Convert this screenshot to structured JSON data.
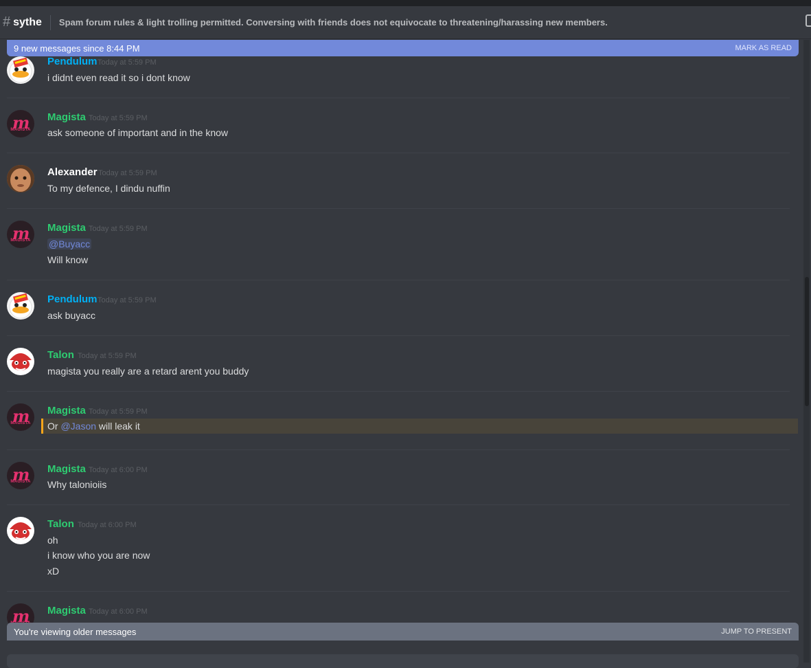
{
  "channel": {
    "hash": "#",
    "name": "sythe",
    "topic": "Spam forum rules & light trolling permitted. Conversing with friends does not equivocate to threatening/harassing new members."
  },
  "new_messages_bar": {
    "text": "9 new messages since 8:44 PM",
    "action": "MARK AS READ"
  },
  "messages": [
    {
      "author": "Pendulum",
      "timestamp": "Today at 5:59 PM",
      "lines": [
        "i didnt even read it so i dont know"
      ]
    },
    {
      "author": "Magista",
      "timestamp": "Today at 5:59 PM",
      "lines": [
        "ask someone of important and in the know"
      ]
    },
    {
      "author": "Alexander",
      "timestamp": "Today at 5:59 PM",
      "lines": [
        "To my defence, I dindu nuffin"
      ]
    },
    {
      "author": "Magista",
      "timestamp": "Today at 5:59 PM",
      "mention": "@Buyacc",
      "lines": [
        "Will know"
      ]
    },
    {
      "author": "Pendulum",
      "timestamp": "Today at 5:59 PM",
      "lines": [
        "ask buyacc"
      ]
    },
    {
      "author": "Talon",
      "timestamp": "Today at 5:59 PM",
      "lines": [
        "magista you really are a retard arent you buddy"
      ]
    },
    {
      "author": "Magista",
      "timestamp": "Today at 5:59 PM",
      "line_prefix": "Or",
      "mention": "@Jason",
      "line_suffix": "will leak it"
    },
    {
      "author": "Magista",
      "timestamp": "Today at 6:00 PM",
      "lines": [
        "Why talonioiis"
      ]
    },
    {
      "author": "Talon",
      "timestamp": "Today at 6:00 PM",
      "lines": [
        "oh",
        "i know who you are now",
        "xD"
      ]
    },
    {
      "author": "Magista",
      "timestamp": "Today at 6:00 PM",
      "lines": []
    }
  ],
  "avatar_labels": {
    "magista": "MAGISTA"
  },
  "older_bar": {
    "text": "You're viewing older messages",
    "action": "JUMP TO PRESENT"
  },
  "colors": {
    "background": "#36393f",
    "accent": "#7289da",
    "pendulum": "#00b0f4",
    "magista": "#2ecc71",
    "talon": "#2ecc71",
    "alexander": "#ffffff",
    "mention_highlight": "#faa61a"
  },
  "icons": [
    "hash-icon",
    "pin-icon"
  ]
}
